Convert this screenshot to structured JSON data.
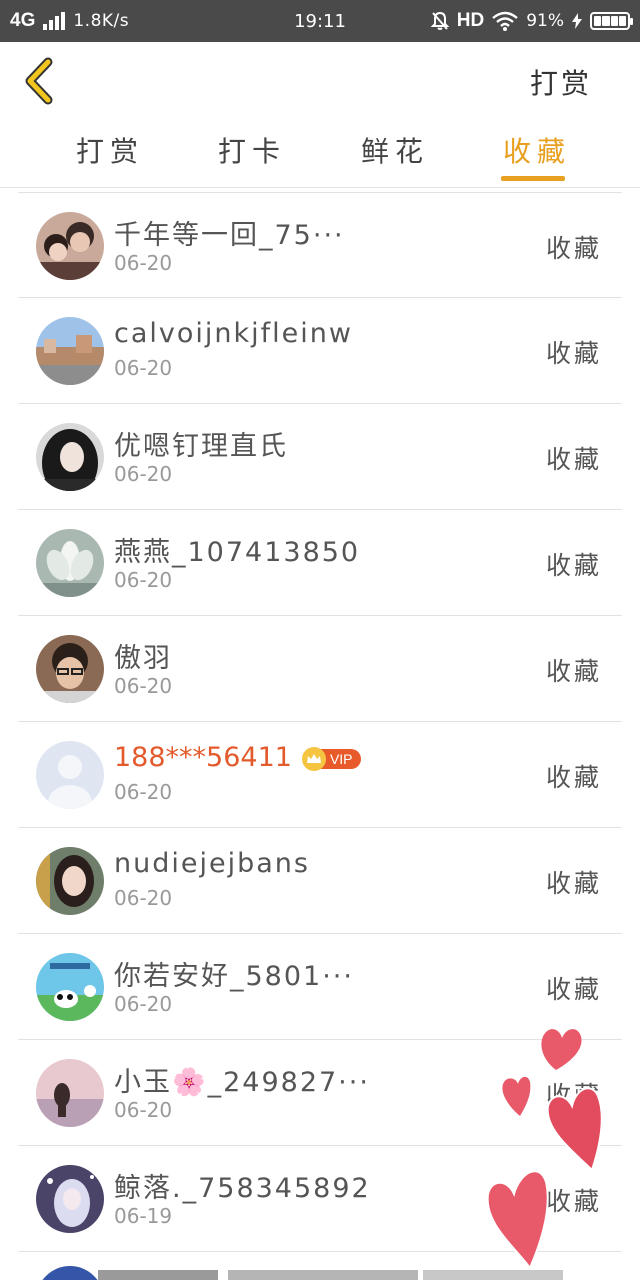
{
  "status_bar": {
    "network": "4G",
    "speed": "1.8K/s",
    "time": "19:11",
    "hd": "HD",
    "battery": "91%"
  },
  "header": {
    "right_label": "打赏"
  },
  "tabs": [
    {
      "label": "打赏",
      "active": false
    },
    {
      "label": "打卡",
      "active": false
    },
    {
      "label": "鲜花",
      "active": false
    },
    {
      "label": "收藏",
      "active": true
    }
  ],
  "accent_color": "#e8a020",
  "list": [
    {
      "name": "千年等一回_75···",
      "date": "06-20",
      "action": "收藏",
      "vip": false
    },
    {
      "name": "calvoijnkjfleinw",
      "date": "06-20",
      "action": "收藏",
      "vip": false
    },
    {
      "name": "优嗯钉理直氏",
      "date": "06-20",
      "action": "收藏",
      "vip": false
    },
    {
      "name": "燕燕_107413850",
      "date": "06-20",
      "action": "收藏",
      "vip": false
    },
    {
      "name": "傲羽",
      "date": "06-20",
      "action": "收藏",
      "vip": false
    },
    {
      "name": "188***56411",
      "date": "06-20",
      "action": "收藏",
      "vip": true,
      "vip_label": "VIP"
    },
    {
      "name": "nudiejejbans",
      "date": "06-20",
      "action": "收藏",
      "vip": false
    },
    {
      "name": "你若安好_5801···",
      "date": "06-20",
      "action": "收藏",
      "vip": false
    },
    {
      "name": "小玉🌸_249827···",
      "date": "06-20",
      "action": "收藏",
      "vip": false
    },
    {
      "name": "鲸落._758345892",
      "date": "06-19",
      "action": "收藏",
      "vip": false
    }
  ]
}
